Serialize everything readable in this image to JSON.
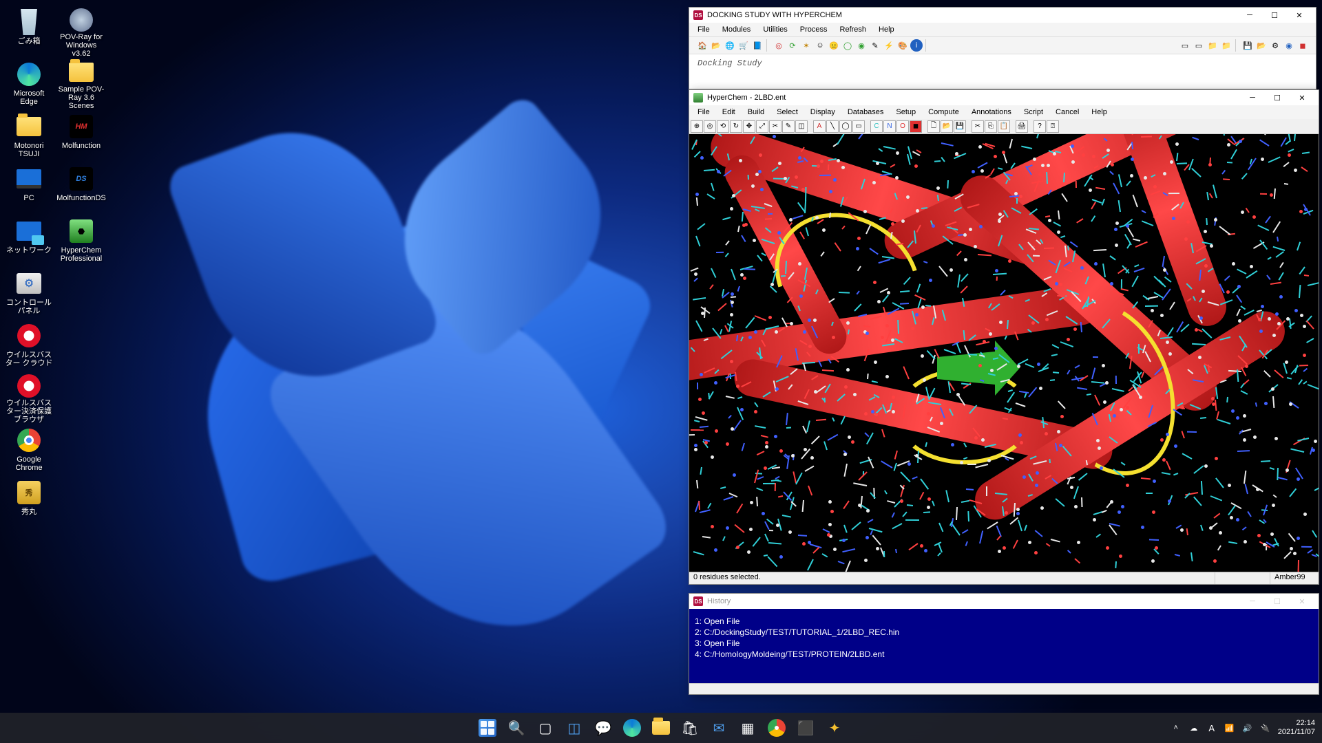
{
  "desktop_icons": {
    "col1": [
      {
        "label": "ごみ箱",
        "icon": "recycle"
      },
      {
        "label": "Microsoft Edge",
        "icon": "edge"
      },
      {
        "label": "Motonori TSUJI",
        "icon": "folder"
      },
      {
        "label": "PC",
        "icon": "pc"
      },
      {
        "label": "ネットワーク",
        "icon": "network"
      },
      {
        "label": "コントロール パネル",
        "icon": "controlpanel"
      },
      {
        "label": "ウイルスバスター クラウド",
        "icon": "trend"
      },
      {
        "label": "ウイルスバスター決済保護ブラウザ",
        "icon": "trend"
      },
      {
        "label": "Google Chrome",
        "icon": "chrome"
      },
      {
        "label": "秀丸",
        "icon": "hidemaru"
      }
    ],
    "col2": [
      {
        "label": "POV-Ray for Windows v3.62",
        "icon": "povray"
      },
      {
        "label": "Sample POV-Ray 3.6 Scenes",
        "icon": "folder"
      },
      {
        "label": "Molfunction",
        "icon": "molfunction"
      },
      {
        "label": "MolfunctionDS",
        "icon": "molfunctionds"
      },
      {
        "label": "HyperChem Professional",
        "icon": "hyperchem"
      }
    ]
  },
  "docking": {
    "title": "DOCKING STUDY WITH HYPERCHEM",
    "menus": [
      "File",
      "Modules",
      "Utilities",
      "Process",
      "Refresh",
      "Help"
    ],
    "body": "Docking Study"
  },
  "hyperchem": {
    "title": "HyperChem - 2LBD.ent",
    "menus": [
      "File",
      "Edit",
      "Build",
      "Select",
      "Display",
      "Databases",
      "Setup",
      "Compute",
      "Annotations",
      "Script",
      "Cancel",
      "Help"
    ],
    "status_left": "0 residues selected.",
    "status_right": "Amber99",
    "atom_labels": {
      "A": "A",
      "C": "C",
      "N": "N",
      "O": "O"
    }
  },
  "history": {
    "title": "History",
    "lines": [
      "1: Open File",
      "2: C:/DockingStudy/TEST/TUTORIAL_1/2LBD_REC.hin",
      "3: Open File",
      "4: C:/HomologyMoldeing/TEST/PROTEIN/2LBD.ent"
    ]
  },
  "taskbar": {
    "time": "22:14",
    "date": "2021/11/07",
    "ime": "A"
  }
}
